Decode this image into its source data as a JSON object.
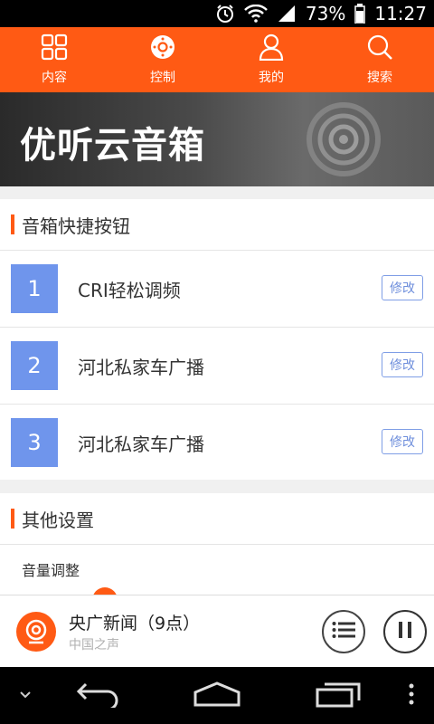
{
  "status_bar": {
    "battery": "73%",
    "time": "11:27",
    "icons": [
      "alarm-icon",
      "wifi-icon",
      "signal-icon",
      "battery-icon"
    ]
  },
  "top_nav": [
    {
      "label": "内容",
      "icon": "grid-icon"
    },
    {
      "label": "控制",
      "icon": "control-icon"
    },
    {
      "label": "我的",
      "icon": "user-icon"
    },
    {
      "label": "搜索",
      "icon": "search-icon"
    }
  ],
  "banner": {
    "title": "优听云音箱"
  },
  "shortcuts": {
    "title": "音箱快捷按钮",
    "items": [
      {
        "number": "1",
        "name": "CRI轻松调频",
        "edit_label": "修改"
      },
      {
        "number": "2",
        "name": "河北私家车广播",
        "edit_label": "修改"
      },
      {
        "number": "3",
        "name": "河北私家车广播",
        "edit_label": "修改"
      }
    ]
  },
  "other_settings": {
    "title": "其他设置",
    "volume_label": "音量调整"
  },
  "player": {
    "title": "央广新闻（9点）",
    "subtitle": "中国之声"
  },
  "colors": {
    "accent": "#ff5a14",
    "number_tile": "#6f95ec",
    "edit_border": "#7f9ee6"
  }
}
